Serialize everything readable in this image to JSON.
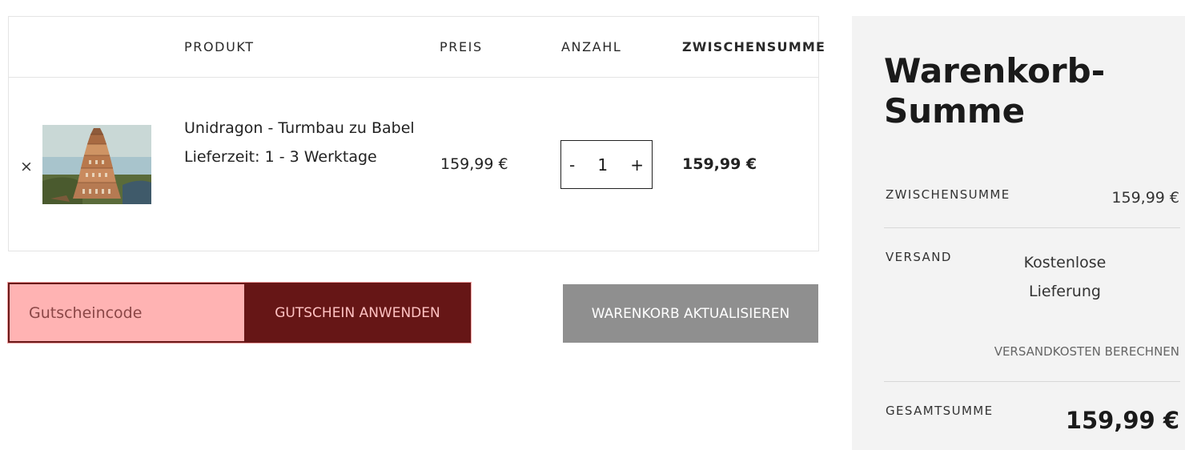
{
  "cart": {
    "headers": {
      "product": "PRODUKT",
      "price": "PREIS",
      "quantity": "ANZAHL",
      "subtotal": "ZWISCHENSUMME"
    },
    "item": {
      "remove": "×",
      "name": "Unidragon - Turmbau zu Babel",
      "delivery": "Lieferzeit: 1 - 3 Werktage",
      "price": "159,99 €",
      "qty_minus": "-",
      "qty_value": "1",
      "qty_plus": "+",
      "subtotal": "159,99 €"
    }
  },
  "coupon": {
    "placeholder": "Gutscheincode",
    "button": "GUTSCHEIN ANWENDEN"
  },
  "update_button": "WARENKORB AKTUALISIEREN",
  "totals": {
    "title": "Warenkorb-Summe",
    "subtotal_label": "ZWISCHENSUMME",
    "subtotal_value": "159,99 €",
    "shipping_label": "VERSAND",
    "shipping_value": "Kostenlose Lieferung",
    "calc_shipping": "VERSANDKOSTEN BERECHNEN",
    "total_label": "GESAMTSUMME",
    "total_value": "159,99 €"
  },
  "colors": {
    "coupon_input_bg": "#ffb3b3",
    "coupon_button_bg": "#661616",
    "update_button_bg": "#8f8f8f",
    "totals_bg": "#f3f3f3"
  },
  "icons": {
    "remove": "close-icon",
    "thumbnail": "tower-of-babel-painting"
  }
}
